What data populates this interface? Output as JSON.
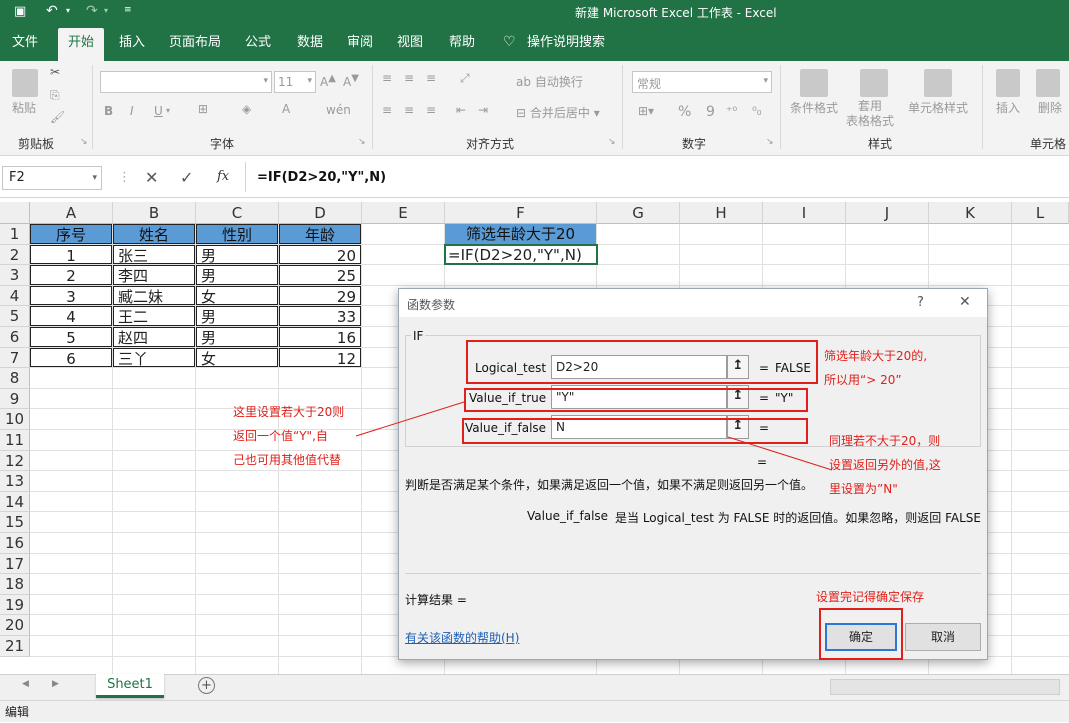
{
  "window": {
    "title": "新建 Microsoft Excel 工作表  -  Excel"
  },
  "menu_tabs": [
    "文件",
    "开始",
    "插入",
    "页面布局",
    "公式",
    "数据",
    "审阅",
    "视图",
    "帮助",
    "操作说明搜索"
  ],
  "ribbon": {
    "clipboard": {
      "paste": "粘贴",
      "label": "剪贴板"
    },
    "font": {
      "size": "11",
      "bold": "B",
      "italic": "I",
      "underline": "U",
      "phonetic": "wén",
      "label": "字体"
    },
    "alignment": {
      "wrap": "自动换行",
      "merge": "合并后居中",
      "label": "对齐方式"
    },
    "number": {
      "format": "常规",
      "percent": "%",
      "comma": "9",
      "label": "数字"
    },
    "styles": {
      "conditional": "条件格式",
      "table": "套用\n表格格式",
      "cell_styles": "单元格样式",
      "label": "样式"
    },
    "cells": {
      "insert": "插入",
      "delete": "删除",
      "label": "单元格"
    }
  },
  "formula_bar": {
    "name_box": "F2",
    "fx": "fx",
    "formula": "=IF(D2>20,\"Y\",N)"
  },
  "columns": [
    "A",
    "B",
    "C",
    "D",
    "E",
    "F",
    "G",
    "H",
    "I",
    "J",
    "K",
    "L"
  ],
  "rows": [
    "1",
    "2",
    "3",
    "4",
    "5",
    "6",
    "7",
    "8",
    "9",
    "10",
    "11",
    "12",
    "13",
    "14",
    "15",
    "16",
    "17",
    "18",
    "19",
    "20",
    "21"
  ],
  "table": {
    "headers": [
      "序号",
      "姓名",
      "性别",
      "年龄"
    ],
    "rows": [
      [
        "1",
        "张三",
        "男",
        "20"
      ],
      [
        "2",
        "李四",
        "男",
        "25"
      ],
      [
        "3",
        "臧二妹",
        "女",
        "29"
      ],
      [
        "4",
        "王二",
        "男",
        "33"
      ],
      [
        "5",
        "赵四",
        "男",
        "16"
      ],
      [
        "6",
        "三丫",
        "女",
        "12"
      ]
    ]
  },
  "f_column": {
    "header": "筛选年龄大于20",
    "formula": "=IF(D2>20,\"Y\",N)"
  },
  "dialog": {
    "title": "函数参数",
    "help_char": "?",
    "close_char": "✕",
    "function": "IF",
    "args": [
      {
        "label": "Logical_test",
        "value": "D2>20",
        "result": "FALSE"
      },
      {
        "label": "Value_if_true",
        "value": "\"Y\"",
        "result": "\"Y\""
      },
      {
        "label": "Value_if_false",
        "value": "N",
        "result": ""
      }
    ],
    "eq": "=",
    "description": "判断是否满足某个条件，如果满足返回一个值，如果不满足则返回另一个值。",
    "arg_desc_name": "Value_if_false",
    "arg_desc": "是当 Logical_test 为 FALSE 时的返回值。如果忽略，则返回 FALSE",
    "result_label": "计算结果 =",
    "help_link": "有关该函数的帮助(H)",
    "ok": "确定",
    "cancel": "取消"
  },
  "annotations": {
    "logical_note_1": "筛选年龄大于20的,",
    "logical_note_2": "所以用“> 20”",
    "true_note_1": "这里设置若大于20则",
    "true_note_2": "返回一个值“Y\",自",
    "true_note_3": "己也可用其他值代替",
    "false_note_1": "同理若不大于20，则",
    "false_note_2": "设置返回另外的值,这",
    "false_note_3": "里设置为”N\"",
    "ok_note": "设置完记得确定保存"
  },
  "sheet_tab": "Sheet1",
  "status": "编辑",
  "colors": {
    "excel_green": "#217346",
    "header_fill": "#5b9bd5",
    "annotation_red": "#e0201b"
  }
}
